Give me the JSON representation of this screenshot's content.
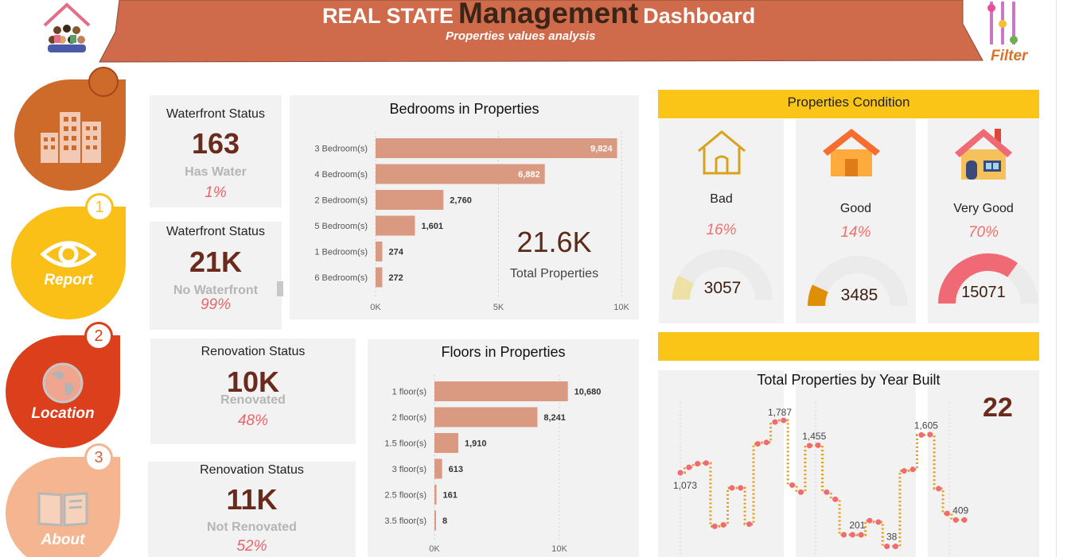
{
  "header": {
    "title_prefix": "REAL STATE",
    "title_main": "Management",
    "title_suffix": "Dashboard",
    "subtitle": "Properties values analysis",
    "filter_label": "Filter"
  },
  "nav": {
    "items": [
      {
        "label": "",
        "icon": "building-icon"
      },
      {
        "label": "Report",
        "badge": "1",
        "icon": "eye-icon"
      },
      {
        "label": "Location",
        "badge": "2",
        "icon": "globe-icon"
      },
      {
        "label": "About",
        "badge": "3",
        "icon": "book-icon"
      }
    ]
  },
  "kpis": {
    "waterfront_yes": {
      "title": "Waterfront Status",
      "value": "163",
      "label": "Has Water",
      "pct": "1%"
    },
    "waterfront_no": {
      "title": "Waterfront Status",
      "value": "21K",
      "label": "No Waterfront",
      "pct": "99%"
    },
    "renovated": {
      "title": "Renovation Status",
      "value": "10K",
      "label": "Renovated",
      "pct": "48%"
    },
    "not_renovated": {
      "title": "Renovation Status",
      "value": "11K",
      "label": "Not Renovated",
      "pct": "52%"
    }
  },
  "bedrooms_chart": {
    "total_value": "21.6K",
    "total_label": "Total Properties"
  },
  "floors_chart": {},
  "condition": {
    "header": "Properties Condition",
    "items": [
      {
        "label": "Bad",
        "pct": "16%",
        "count": "3057",
        "fraction": 0.16,
        "color": "#ede1a6",
        "icon": "house-outline-icon"
      },
      {
        "label": "Good",
        "pct": "14%",
        "count": "3485",
        "fraction": 0.14,
        "color": "#df8f06",
        "icon": "house-orange-icon"
      },
      {
        "label": "Very Good",
        "pct": "70%",
        "count": "15071",
        "fraction": 0.7,
        "color": "#f06a75",
        "icon": "house-colored-icon"
      }
    ]
  },
  "year_built": {
    "title": "Total Properties by Year Built",
    "kpi_value": "22"
  },
  "chart_data": [
    {
      "type": "bar",
      "orientation": "horizontal",
      "title": "Bedrooms in Properties",
      "categories": [
        "3 Bedroom(s)",
        "4 Bedroom(s)",
        "2 Bedroom(s)",
        "5 Bedroom(s)",
        "1 Bedroom(s)",
        "6 Bedroom(s)"
      ],
      "values": [
        9824,
        6882,
        2760,
        1601,
        274,
        272
      ],
      "data_labels": [
        "9,824",
        "6,882",
        "2,760",
        "1,601",
        "274",
        "272"
      ],
      "xticks": [
        "0K",
        "5K",
        "10K"
      ],
      "xlim": [
        0,
        10000
      ],
      "color": "#d99a81"
    },
    {
      "type": "bar",
      "orientation": "horizontal",
      "title": "Floors in Properties",
      "categories": [
        "1 floor(s)",
        "2 floor(s)",
        "1.5 floor(s)",
        "3 floor(s)",
        "2.5 floor(s)",
        "3.5 floor(s)"
      ],
      "values": [
        10680,
        8241,
        1910,
        613,
        161,
        8
      ],
      "data_labels": [
        "10,680",
        "8,241",
        "1,910",
        "613",
        "161",
        "8"
      ],
      "xticks": [
        "0K",
        "10K"
      ],
      "xlim": [
        0,
        10000
      ],
      "color": "#d99a81"
    },
    {
      "type": "line",
      "step": true,
      "title": "Total Properties by Year Built",
      "values": [
        1073,
        1150,
        1200,
        1210,
        320,
        340,
        860,
        860,
        350,
        1480,
        1500,
        1787,
        1810,
        900,
        800,
        1455,
        1460,
        800,
        700,
        201,
        201,
        200,
        400,
        380,
        38,
        38,
        1100,
        1120,
        1605,
        1610,
        850,
        500,
        409,
        409
      ],
      "data_labels": [
        {
          "index": 0,
          "text": "1,073"
        },
        {
          "index": 11,
          "text": "1,787"
        },
        {
          "index": 15,
          "text": "1,455"
        },
        {
          "index": 20,
          "text": "201"
        },
        {
          "index": 24,
          "text": "38"
        },
        {
          "index": 28,
          "text": "1,605"
        },
        {
          "index": 32,
          "text": "409"
        }
      ],
      "line_color": "#e69a14",
      "marker_color": "#f06a75",
      "ylim": [
        0,
        1900
      ]
    }
  ]
}
